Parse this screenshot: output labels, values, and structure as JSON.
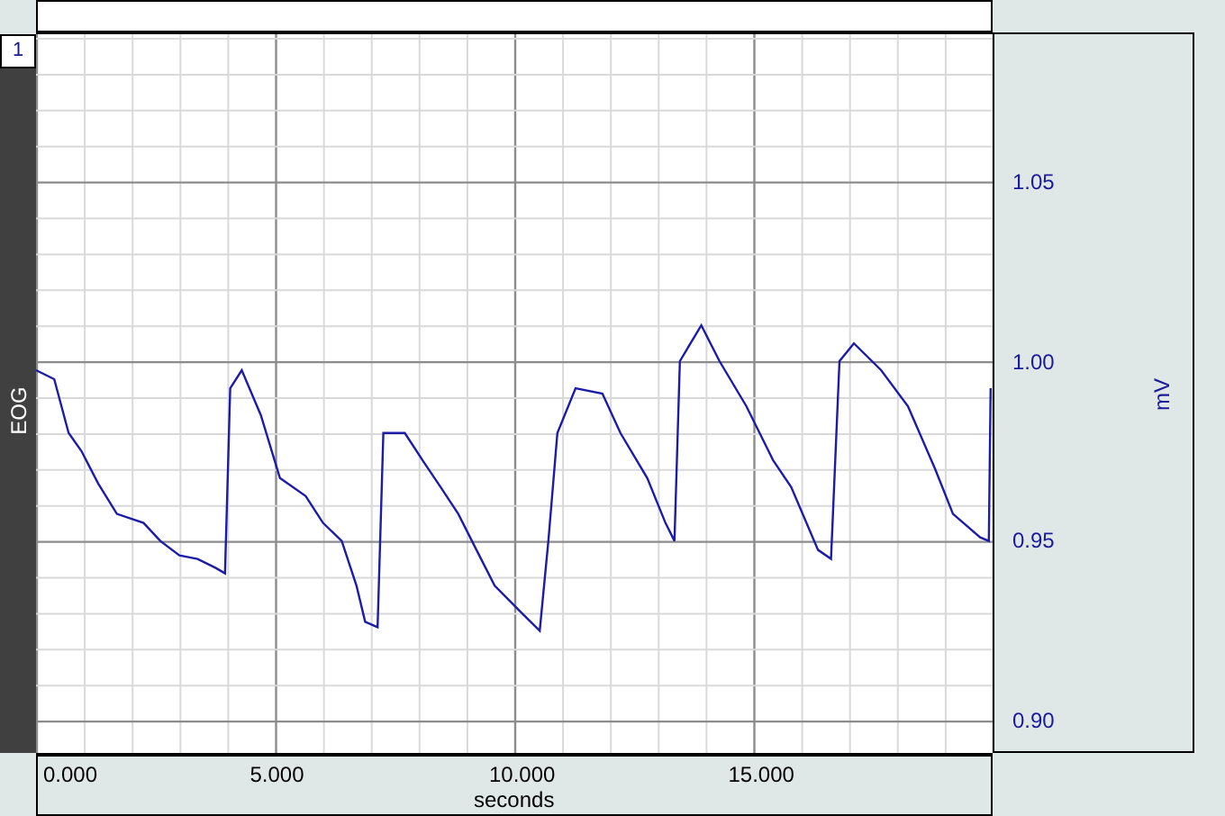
{
  "channel": {
    "number": "1"
  },
  "chart_data": {
    "type": "line",
    "grid": true,
    "xlabel": "seconds",
    "ylabel": "mV",
    "xlim": [
      0,
      20
    ],
    "ylim": [
      0.891,
      1.091
    ],
    "xticks": [
      {
        "value": 0,
        "label": "0.000"
      },
      {
        "value": 5,
        "label": "5.000"
      },
      {
        "value": 10,
        "label": "10.000"
      },
      {
        "value": 15,
        "label": "15.000"
      }
    ],
    "yticks": [
      {
        "value": 0.9,
        "label": "0.90"
      },
      {
        "value": 0.95,
        "label": "0.95"
      },
      {
        "value": 1.0,
        "label": "1.00"
      },
      {
        "value": 1.05,
        "label": "1.05"
      }
    ],
    "x": [
      0,
      0.38,
      0.68,
      0.95,
      1.3,
      1.69,
      2.25,
      2.6,
      3.0,
      3.38,
      3.76,
      3.95,
      4.06,
      4.3,
      4.7,
      5.1,
      5.64,
      6.0,
      6.39,
      6.7,
      6.88,
      7.14,
      7.26,
      7.71,
      8.08,
      8.46,
      8.83,
      9.21,
      9.59,
      10.15,
      10.53,
      10.71,
      10.9,
      11.28,
      11.84,
      12.22,
      12.78,
      13.16,
      13.35,
      13.46,
      13.91,
      14.29,
      14.85,
      15.41,
      15.79,
      16.35,
      16.62,
      16.8,
      17.1,
      17.67,
      18.23,
      18.8,
      19.17,
      19.74,
      19.92,
      19.96
    ],
    "series": [
      {
        "name": "EOG",
        "color": "#1c1ca8",
        "values": [
          0.9975,
          0.995,
          0.98,
          0.975,
          0.966,
          0.9575,
          0.955,
          0.95,
          0.946,
          0.945,
          0.9425,
          0.941,
          0.9925,
          0.9975,
          0.985,
          0.9675,
          0.9625,
          0.955,
          0.95,
          0.9375,
          0.9275,
          0.926,
          0.98,
          0.98,
          0.9725,
          0.965,
          0.9575,
          0.9475,
          0.9375,
          0.93,
          0.925,
          0.95,
          0.98,
          0.9925,
          0.991,
          0.98,
          0.9675,
          0.955,
          0.95,
          1.0,
          1.01,
          1.0,
          0.9875,
          0.9725,
          0.965,
          0.9475,
          0.945,
          1.0,
          1.005,
          0.9975,
          0.9875,
          0.97,
          0.9575,
          0.951,
          0.95,
          0.9925
        ]
      }
    ]
  }
}
